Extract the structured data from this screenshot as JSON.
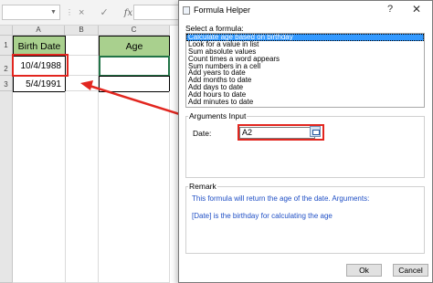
{
  "excel": {
    "formula_bar": {
      "cancel_icon": "×",
      "enter_icon": "✓",
      "function_icon": "fx"
    },
    "columns": [
      "A",
      "B",
      "C"
    ],
    "rows": [
      "1",
      "2",
      "3"
    ],
    "cells": {
      "a1": "Birth Date",
      "a2": "10/4/1988",
      "a3": "5/4/1991",
      "c1": "Age"
    },
    "colors": {
      "header_fill": "#a9d08e",
      "highlight": "#e2261f"
    }
  },
  "dialog": {
    "title": "Formula Helper",
    "help": "?",
    "close": "✕",
    "select_label": "Select a formula:",
    "formulas": [
      "Calculate age based on birthday",
      "Look for a value in list",
      "Sum absolute values",
      "Count times a word appears",
      "Sum numbers in a cell",
      "Add years to date",
      "Add months to date",
      "Add days to date",
      "Add hours to date",
      "Add minutes to date"
    ],
    "selected_index": 0,
    "arguments_title": "Arguments Input",
    "date_label": "Date:",
    "date_value": "A2",
    "remark_title": "Remark",
    "remark_line1": "This formula will return the age of the date. Arguments:",
    "remark_line2": "[Date] is the birthday for calculating the age",
    "ok_label": "Ok",
    "cancel_label": "Cancel"
  }
}
